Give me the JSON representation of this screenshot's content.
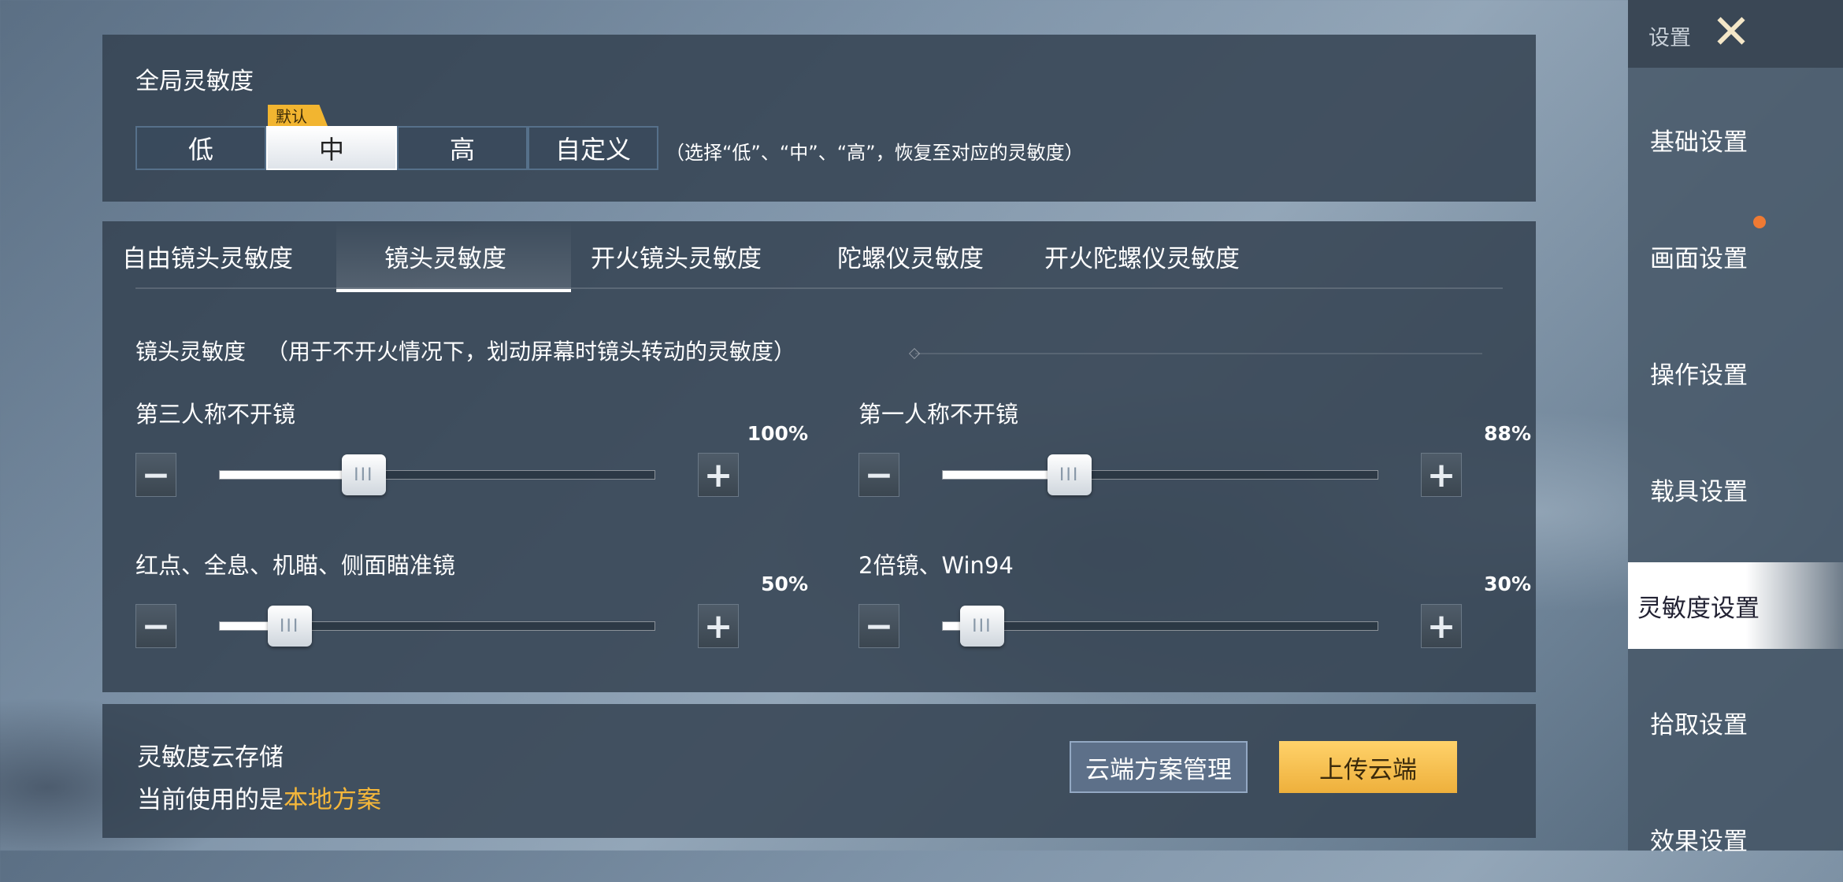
{
  "global": {
    "title": "全局灵敏度",
    "options": [
      "低",
      "中",
      "高",
      "自定义"
    ],
    "selected": "中",
    "default_tag": "默认",
    "hint": "（选择“低”、“中”、“高”，恢复至对应的灵敏度）"
  },
  "tabs": [
    "自由镜头灵敏度",
    "镜头灵敏度",
    "开火镜头灵敏度",
    "陀螺仪灵敏度",
    "开火陀螺仪灵敏度"
  ],
  "active_tab": "镜头灵敏度",
  "section": {
    "title": "镜头灵敏度",
    "description": "（用于不开火情况下，划动屏幕时镜头转动的灵敏度）"
  },
  "sliders": [
    {
      "label": "第三人称不开镜",
      "value_text": "100%",
      "fraction": 0.33
    },
    {
      "label": "第一人称不开镜",
      "value_text": "88%",
      "fraction": 0.29
    },
    {
      "label": "红点、全息、机瞄、侧面瞄准镜",
      "value_text": "50%",
      "fraction": 0.16
    },
    {
      "label": "2倍镜、Win94",
      "value_text": "30%",
      "fraction": 0.09
    }
  ],
  "cloud": {
    "title": "灵敏度云存储",
    "current_prefix": "当前使用的是",
    "current_scheme": "本地方案",
    "manage_button": "云端方案管理",
    "upload_button": "上传云端"
  },
  "sidebar": {
    "header": "设置",
    "items": [
      "基础设置",
      "画面设置",
      "操作设置",
      "载具设置",
      "灵敏度设置",
      "拾取设置",
      "效果设置"
    ],
    "active": "灵敏度设置"
  },
  "colors": {
    "accent_gold": "#f2b530",
    "highlight_text": "#f5b73a",
    "notification_dot": "#ef7a33"
  }
}
